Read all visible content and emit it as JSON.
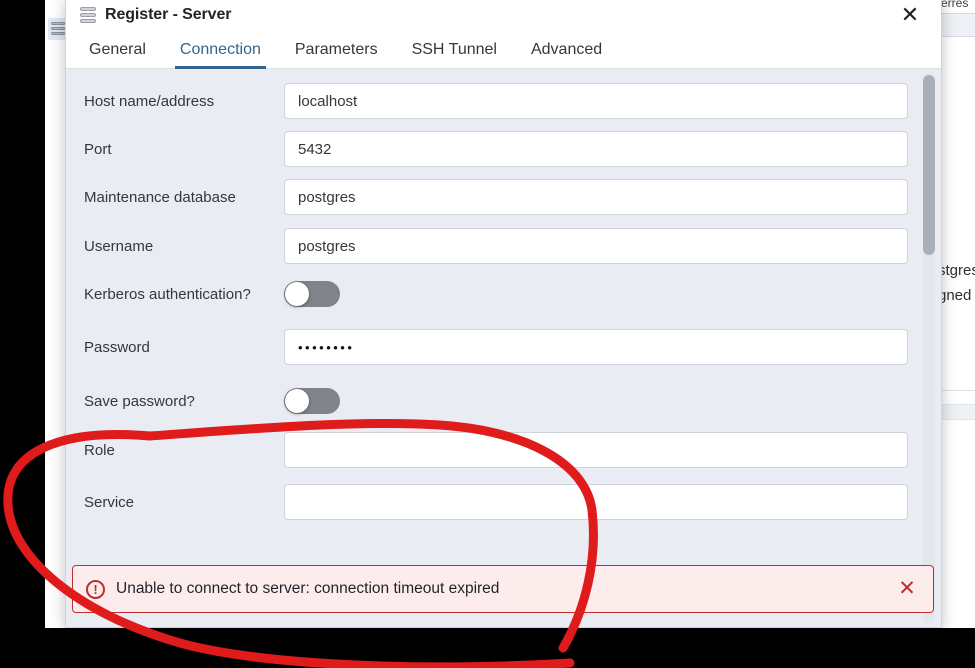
{
  "dialog": {
    "title": "Register - Server",
    "title_icon": "server-stack-icon",
    "close_label": "✕",
    "tabs": [
      {
        "label": "General",
        "active": false
      },
      {
        "label": "Connection",
        "active": true
      },
      {
        "label": "Parameters",
        "active": false
      },
      {
        "label": "SSH Tunnel",
        "active": false
      },
      {
        "label": "Advanced",
        "active": false
      }
    ],
    "fields": [
      {
        "label": "Host name/address",
        "type": "text",
        "value": "localhost",
        "placeholder": ""
      },
      {
        "label": "Port",
        "type": "text",
        "value": "5432",
        "placeholder": ""
      },
      {
        "label": "Maintenance database",
        "type": "text",
        "value": "postgres",
        "placeholder": ""
      },
      {
        "label": "Username",
        "type": "text",
        "value": "postgres",
        "placeholder": ""
      },
      {
        "label": "Kerberos authentication?",
        "type": "toggle",
        "value": "off"
      },
      {
        "label": "Password",
        "type": "password",
        "value": "••••••••",
        "placeholder": ""
      },
      {
        "label": "Save password?",
        "type": "toggle",
        "value": "off"
      },
      {
        "label": "Role",
        "type": "text",
        "value": "",
        "placeholder": ""
      },
      {
        "label": "Service",
        "type": "text",
        "value": "",
        "placeholder": ""
      }
    ]
  },
  "alert": {
    "icon": "error-exclamation-icon",
    "message": "Unable to connect to server: connection timeout expired",
    "close_label": "✕",
    "border_color": "#c32f2f",
    "background_color": "#fdecec"
  },
  "background": {
    "right_text_line1": "stgres",
    "right_text_line2": "gned",
    "top_strip_text": "erres"
  },
  "annotation": {
    "type": "hand-drawn-ellipse",
    "color": "#e01b1b"
  },
  "colors": {
    "accent": "#326690",
    "form_bg": "#e9edf3",
    "toggle_off": "#808389"
  }
}
